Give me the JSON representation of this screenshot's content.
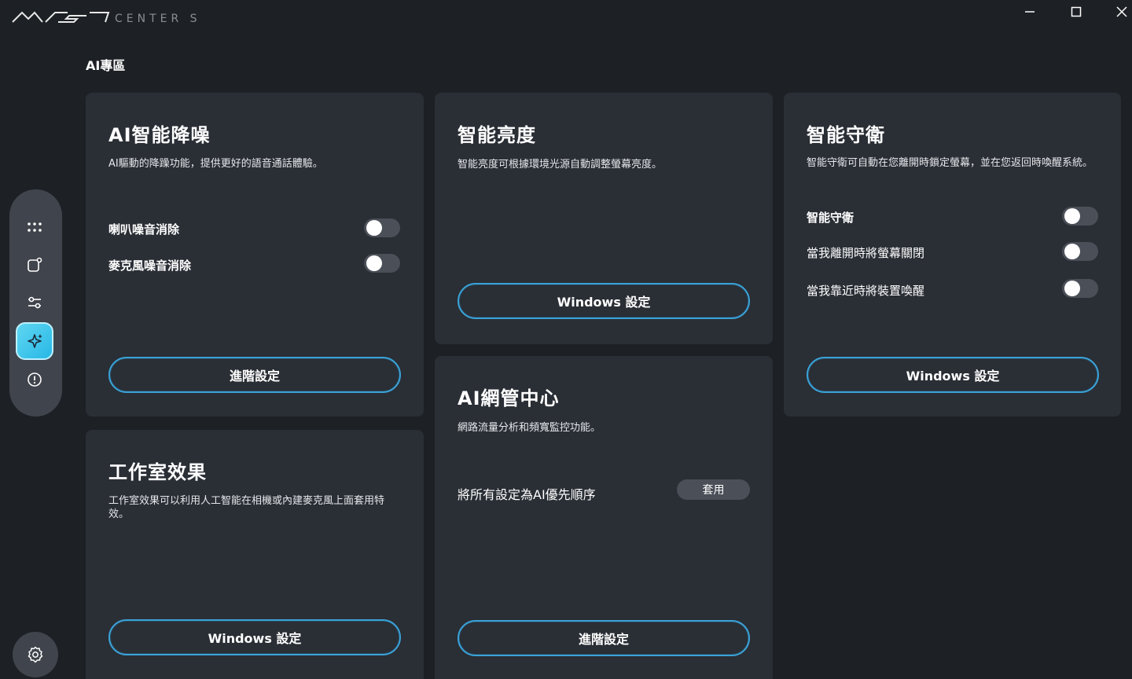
{
  "app": {
    "logo_text": "MSI CENTER S",
    "page_title": "AI專區"
  },
  "window_controls": [
    "minimize-icon",
    "maximize-icon",
    "close-icon"
  ],
  "sidebar": {
    "items": [
      {
        "icon": "grid-dots-icon"
      },
      {
        "icon": "notification-app-icon"
      },
      {
        "icon": "sliders-icon"
      },
      {
        "icon": "ai-sparkle-icon",
        "active": true
      },
      {
        "icon": "alert-circle-icon"
      }
    ],
    "settings_icon": "gear-icon"
  },
  "cards": {
    "noise": {
      "title": "AI智能降噪",
      "desc": "AI驅動的降躁功能，提供更好的語音通話體驗。",
      "rows": [
        {
          "label": "喇叭噪音消除",
          "on": false
        },
        {
          "label": "麥克風噪音消除",
          "on": false
        }
      ],
      "button": "進階設定"
    },
    "brightness": {
      "title": "智能亮度",
      "desc": "智能亮度可根據環境光源自動調整螢幕亮度。",
      "button": "Windows 設定"
    },
    "guard": {
      "title": "智能守衛",
      "desc": "智能守衛可自動在您離開時鎖定螢幕，並在您返回時喚醒系統。",
      "rows": [
        {
          "label": "智能守衛",
          "on": false
        },
        {
          "label": "當我離開時將螢幕關閉",
          "on": false
        },
        {
          "label": "當我靠近時將裝置喚醒",
          "on": false
        }
      ],
      "button": "Windows 設定"
    },
    "studio": {
      "title": "工作室效果",
      "desc": "工作室效果可以利用人工智能在相機或內建麥克風上面套用特效。",
      "button": "Windows 設定"
    },
    "network": {
      "title": "AI網管中心",
      "desc": "網路流量分析和頻寬監控功能。",
      "row_label": "將所有設定為AI優先順序",
      "apply_button": "套用",
      "button": "進階設定"
    }
  },
  "colors": {
    "background": "#1d2025",
    "card": "#2a2e35",
    "accent": "#3aa3d8",
    "active_nav": "#28b8e6"
  }
}
